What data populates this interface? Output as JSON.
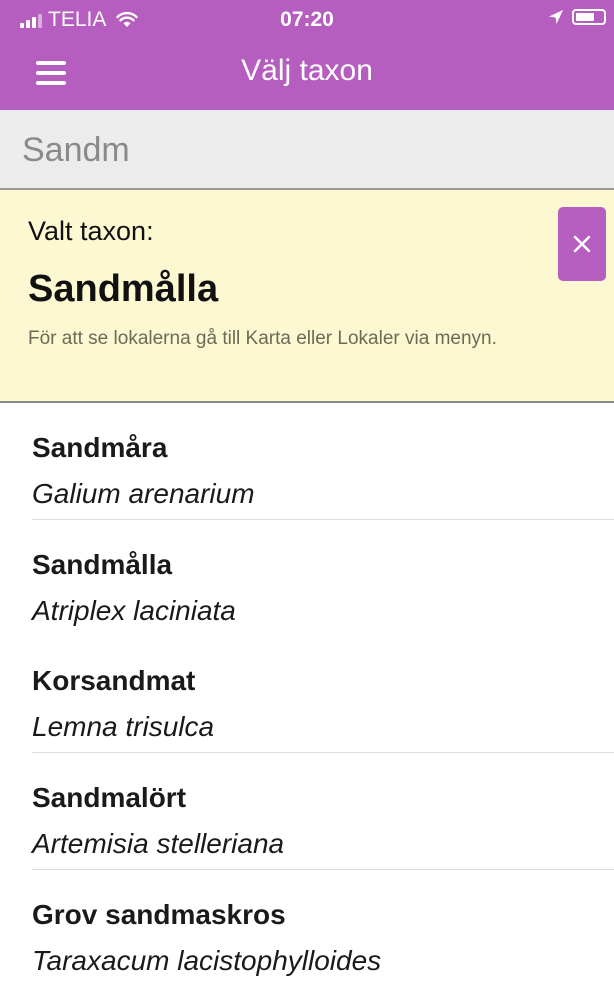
{
  "status_bar": {
    "carrier": "TELIA",
    "time": "07:20"
  },
  "nav": {
    "title": "Välj taxon"
  },
  "search": {
    "value": "Sandm"
  },
  "selected_taxon": {
    "label": "Valt taxon:",
    "name": "Sandmålla",
    "hint": "För att se lokalerna gå till Karta eller Lokaler via menyn."
  },
  "results": [
    {
      "common": "Sandmåra",
      "latin": "Galium arenarium"
    },
    {
      "common": "Sandmålla",
      "latin": "Atriplex laciniata"
    },
    {
      "common": "Korsandmat",
      "latin": "Lemna trisulca"
    },
    {
      "common": "Sandmalört",
      "latin": "Artemisia stelleriana"
    },
    {
      "common": "Grov sandmaskros",
      "latin": "Taraxacum lacistophylloides"
    }
  ],
  "colors": {
    "accent": "#b55ec0",
    "selected_bg": "#fbf8d2",
    "search_bg": "#ececec"
  },
  "icons": [
    "signal-icon",
    "wifi-icon",
    "location-arrow-icon",
    "battery-icon",
    "hamburger-menu-icon",
    "close-icon"
  ]
}
